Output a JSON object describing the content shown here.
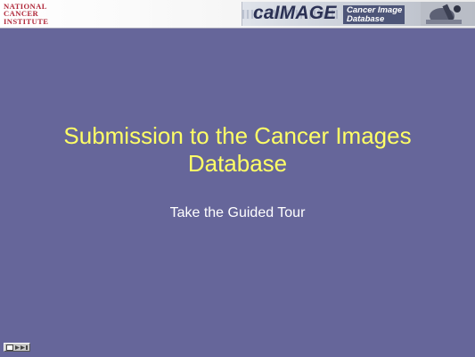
{
  "header": {
    "logo_lines": [
      "NATIONAL",
      "CANCER",
      "INSTITUTE"
    ],
    "banner_title": "caIMAGE",
    "banner_subtitle_line1": "Cancer Image",
    "banner_subtitle_line2": "Database"
  },
  "slide": {
    "title_line1": "Submission to the Cancer Images",
    "title_line2": "Database",
    "subtitle": "Take the Guided Tour"
  },
  "nav": {
    "icon": "slideshow-nav-icon"
  },
  "colors": {
    "background": "#66669a",
    "title": "#ffff66",
    "subtitle": "#ffffff",
    "logo": "#b0283a"
  }
}
